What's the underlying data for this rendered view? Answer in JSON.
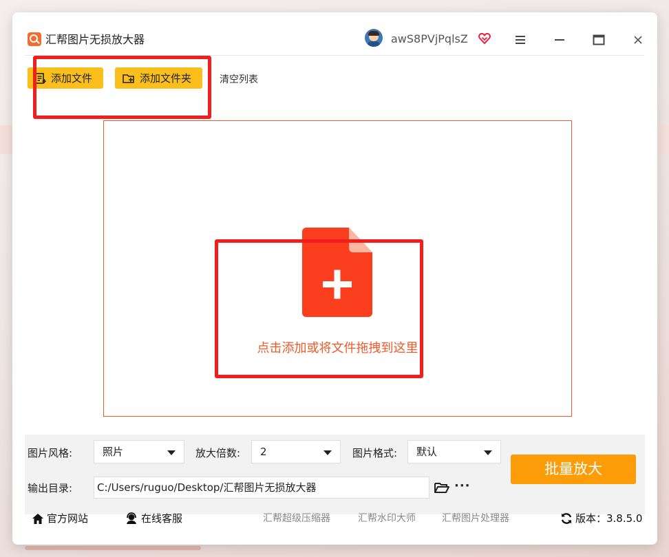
{
  "app": {
    "title": "汇帮图片无损放大器",
    "username": "awS8PVjPqlsZ"
  },
  "toolbar": {
    "add_file": "添加文件",
    "add_folder": "添加文件夹",
    "clear_list": "清空列表"
  },
  "dropzone": {
    "text": "点击添加或将文件拖拽到这里"
  },
  "settings": {
    "style_label": "图片风格:",
    "style_value": "照片",
    "scale_label": "放大倍数:",
    "scale_value": "2",
    "format_label": "图片格式:",
    "format_value": "默认",
    "output_label": "输出目录:",
    "output_path": "C:/Users/ruguo/Desktop/汇帮图片无损放大器",
    "more": "···",
    "batch_button": "批量放大"
  },
  "footer": {
    "website": "官方网站",
    "support": "在线客服",
    "link1": "汇帮超级压缩器",
    "link2": "汇帮水印大师",
    "link3": "汇帮图片处理器",
    "version": "版本：3.8.5.0"
  },
  "colors": {
    "accent_yellow": "#fbbf1b",
    "batch_orange": "#fc9c08",
    "drop_accent": "#ee5a2a",
    "annotation_red": "#f11e1e"
  },
  "icons": [
    "app-logo-icon",
    "avatar-icon",
    "vip-heart-icon",
    "menu-icon",
    "minimize-icon",
    "maximize-icon",
    "close-icon",
    "add-file-icon",
    "add-folder-icon",
    "file-plus-icon",
    "folder-open-icon",
    "home-icon",
    "headset-icon",
    "refresh-icon"
  ]
}
